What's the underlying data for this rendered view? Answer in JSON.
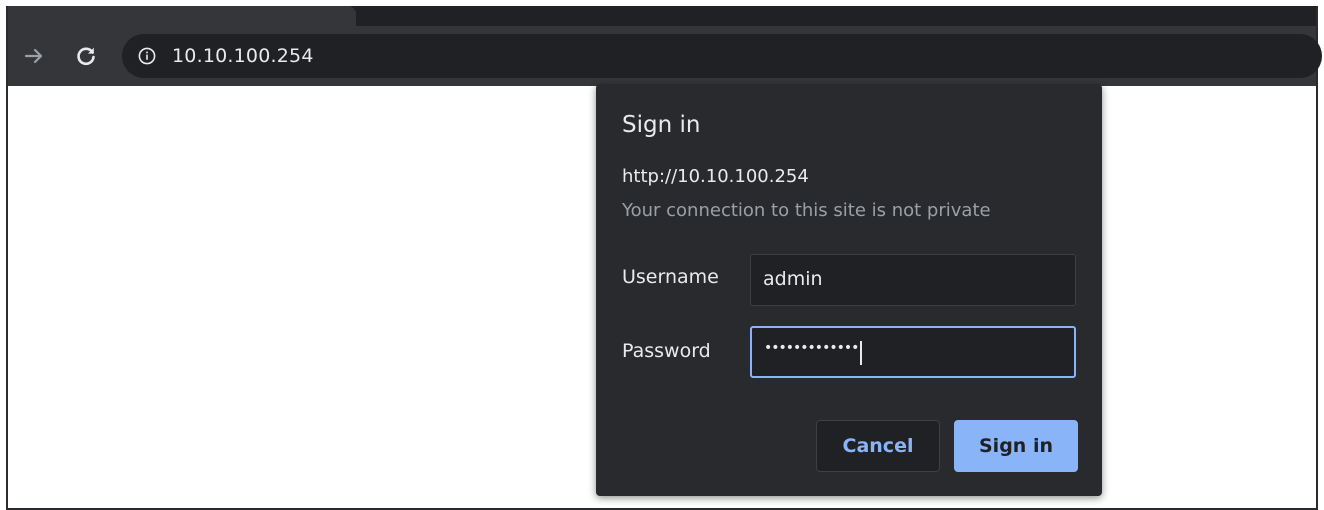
{
  "browser": {
    "address_bar": {
      "url": "10.10.100.254",
      "info_icon": "info-icon"
    },
    "nav": {
      "forward_icon": "arrow-right-icon",
      "reload_icon": "reload-icon"
    }
  },
  "dialog": {
    "title": "Sign in",
    "origin": "http://10.10.100.254",
    "warning": "Your connection to this site is not private",
    "username": {
      "label": "Username",
      "value": "admin"
    },
    "password": {
      "label": "Password",
      "masked_value": "•••••••••••••"
    },
    "buttons": {
      "cancel": "Cancel",
      "sign_in": "Sign in"
    }
  },
  "colors": {
    "toolbar": "#35363a",
    "omnibox": "#202124",
    "dialog_bg": "#292a2d",
    "accent": "#8ab4f8",
    "muted_text": "#9aa0a6"
  }
}
